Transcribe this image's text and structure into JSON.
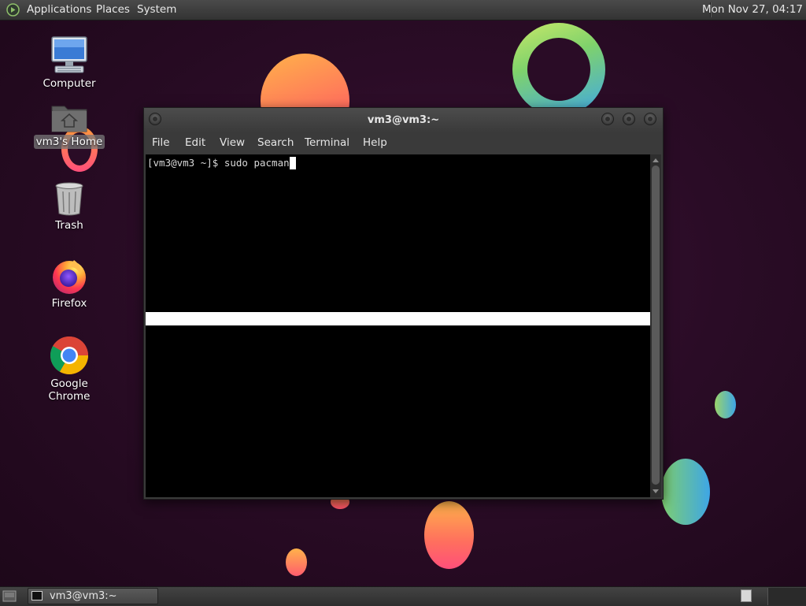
{
  "top_panel": {
    "applications_label": "Applications",
    "places_label": "Places",
    "system_label": "System",
    "clock": "Mon Nov 27, 04:17"
  },
  "desktop": {
    "icons": [
      {
        "label": "Computer",
        "icon": "computer-icon"
      },
      {
        "label": "vm3's Home",
        "icon": "home-folder-icon"
      },
      {
        "label": "Trash",
        "icon": "trash-icon"
      },
      {
        "label": "Firefox",
        "icon": "firefox-icon"
      },
      {
        "label": "Google Chrome",
        "icon": "chrome-icon"
      }
    ]
  },
  "terminal": {
    "title": "vm3@vm3:~",
    "menu": [
      "File",
      "Edit",
      "View",
      "Search",
      "Terminal",
      "Help"
    ],
    "prompt": "[vm3@vm3 ~]$ sudo pacman"
  },
  "bottom_panel": {
    "task_label": "vm3@vm3:~"
  },
  "colors": {
    "background": "#2a0c26",
    "panel": "#3c3c3c",
    "terminal_bg": "#000000",
    "terminal_text": "#d8d8d8"
  }
}
